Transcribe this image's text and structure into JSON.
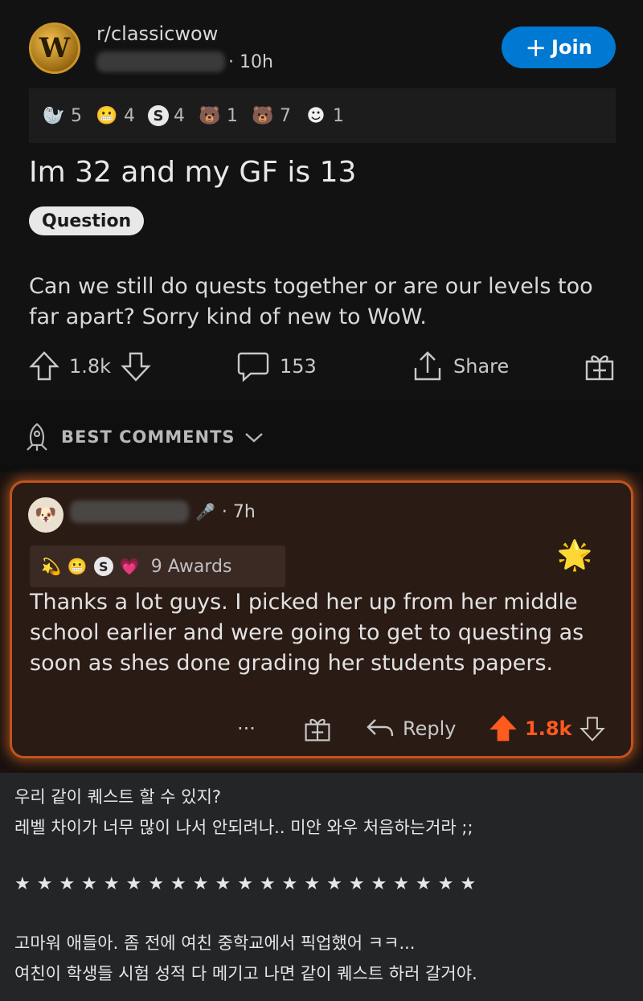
{
  "post": {
    "subreddit": "r/classicwow",
    "time": "· 10h",
    "join_label": "Join",
    "awards": [
      {
        "icon": "wholesome-seal-icon",
        "glyph": "🦭",
        "count": "5"
      },
      {
        "icon": "helpful-icon",
        "glyph": "😬",
        "count": "4"
      },
      {
        "icon": "silver-icon",
        "glyph": "S",
        "count": "4"
      },
      {
        "icon": "bear-icon",
        "glyph": "🐻",
        "count": "1"
      },
      {
        "icon": "gold-bear-icon",
        "glyph": "🐻",
        "count": "7"
      },
      {
        "icon": "snoo-icon",
        "glyph": "☻",
        "count": "1"
      }
    ],
    "title": "Im 32 and my GF is 13",
    "flair": "Question",
    "body": "Can we still do quests together or are our levels too far apart? Sorry kind of new to WoW.",
    "upvotes": "1.8k",
    "comments": "153",
    "share_label": "Share"
  },
  "best_comments_label": "BEST COMMENTS",
  "comment": {
    "time": "· 7h",
    "awards_label": "9 Awards",
    "body": "Thanks a lot guys. I picked her up from her middle school earlier and were going to get to questing as soon as shes done grading her students papers.",
    "more_label": "···",
    "reply_label": "Reply",
    "score": "1.8k"
  },
  "caption": {
    "line1": "우리 같이 퀘스트 할 수 있지?",
    "line2": "레벨 차이가 너무 많이 나서 안되려나.. 미안 와우 처음하는거라 ;;",
    "stars": "★★★★★★★★★★★★★★★★★★★★★",
    "line3": "고마워 애들아. 좀 전에 여친 중학교에서 픽업했어 ㅋㅋ...",
    "line4": "여친이 학생들 시험 성적 다 메기고 나면 같이 퀘스트 하러 갈거야."
  },
  "colors": {
    "accent_blue": "#0079d3",
    "upvote_orange": "#ff5a1f",
    "comment_glow": "#c0531e"
  }
}
